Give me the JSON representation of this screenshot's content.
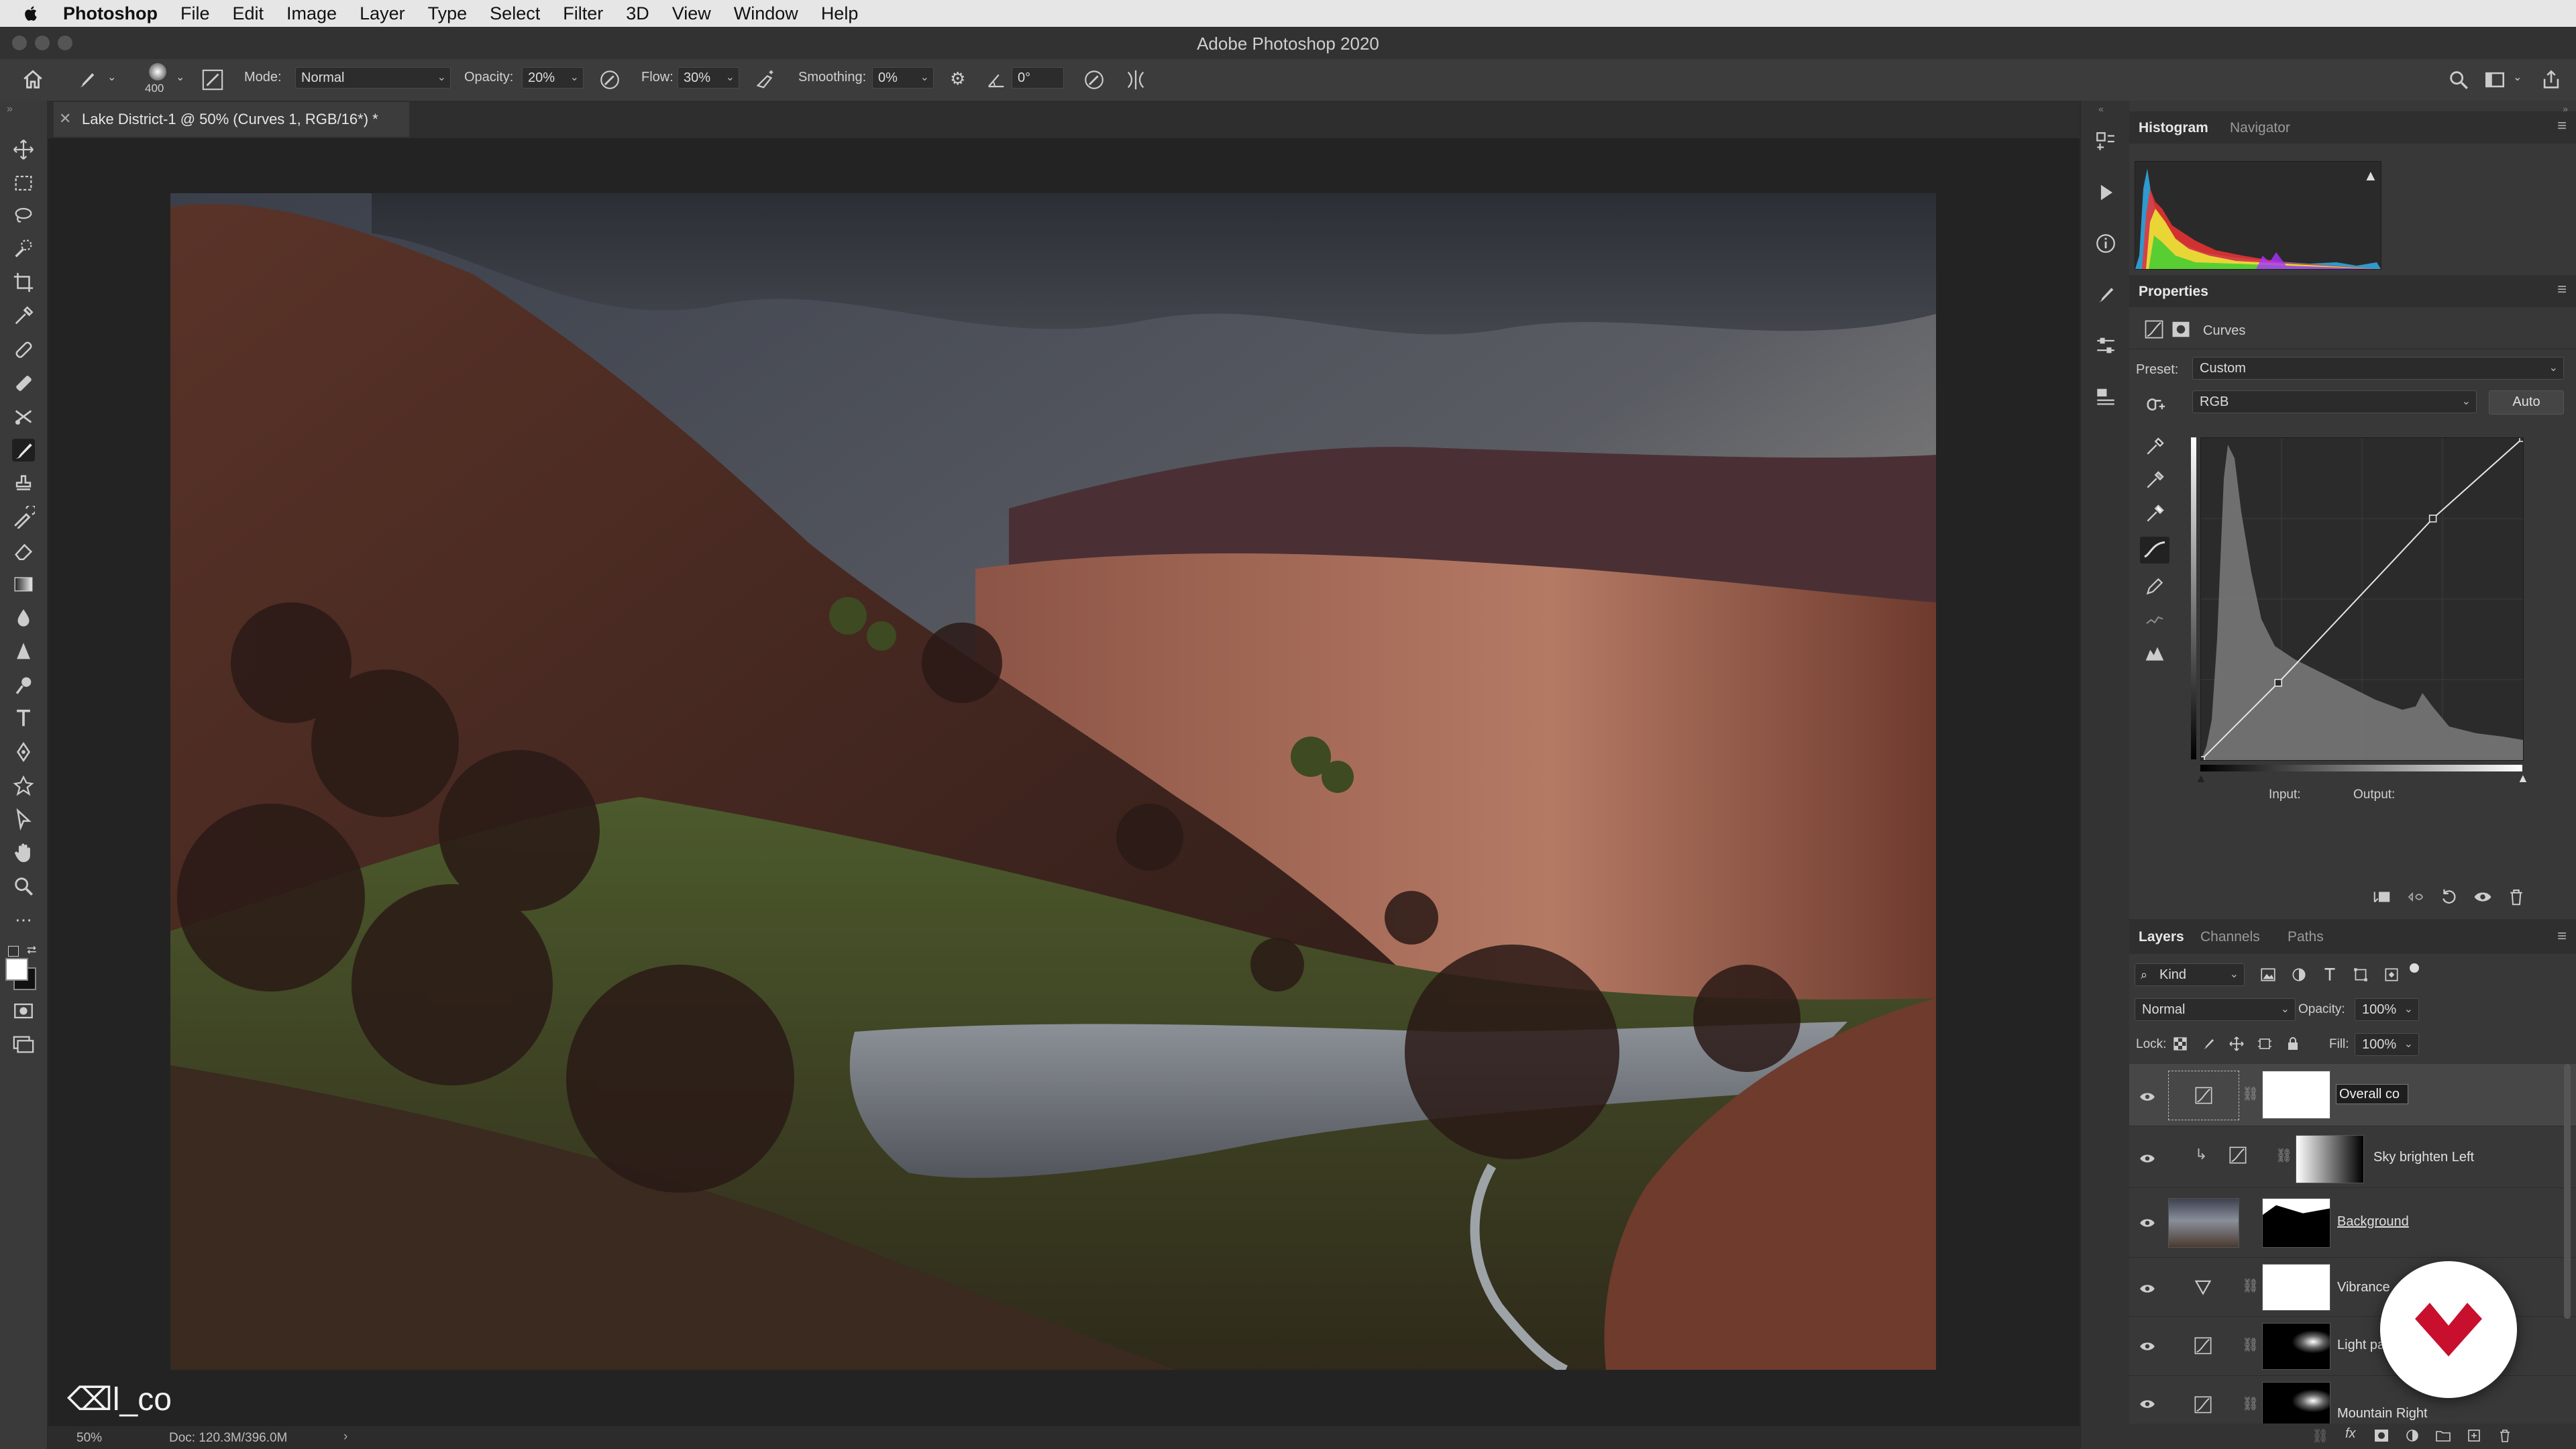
{
  "menubar": {
    "app": "Photoshop",
    "items": [
      "File",
      "Edit",
      "Image",
      "Layer",
      "Type",
      "Select",
      "Filter",
      "3D",
      "View",
      "Window",
      "Help"
    ]
  },
  "window": {
    "title": "Adobe Photoshop 2020"
  },
  "options": {
    "brush_size": "400",
    "mode_label": "Mode:",
    "mode_value": "Normal",
    "opacity_label": "Opacity:",
    "opacity_value": "20%",
    "flow_label": "Flow:",
    "flow_value": "30%",
    "smoothing_label": "Smoothing:",
    "smoothing_value": "0%",
    "angle_value": "0°"
  },
  "document": {
    "tab_title": "Lake District-1 @ 50% (Curves 1, RGB/16*) *",
    "zoom": "50%",
    "doc_size": "Doc: 120.3M/396.0M",
    "watermark": "l_co"
  },
  "histogram_panel": {
    "tabs": [
      "Histogram",
      "Navigator"
    ]
  },
  "properties": {
    "header": "Properties",
    "kind": "Curves",
    "preset_label": "Preset:",
    "preset_value": "Custom",
    "channel_value": "RGB",
    "auto_button": "Auto",
    "input_label": "Input:",
    "output_label": "Output:",
    "curve_points": [
      [
        0,
        0
      ],
      [
        0.24,
        0.24
      ],
      [
        0.72,
        0.75
      ],
      [
        1,
        1
      ]
    ]
  },
  "layers_panel": {
    "tabs": [
      "Layers",
      "Channels",
      "Paths"
    ],
    "filter_kind": "Kind",
    "blend_mode": "Normal",
    "opacity_label": "Opacity:",
    "opacity_value": "100%",
    "lock_label": "Lock:",
    "fill_label": "Fill:",
    "fill_value": "100%",
    "layers": [
      {
        "name": "Overall co"
      },
      {
        "name": "Sky brighten Left"
      },
      {
        "name": "Background"
      },
      {
        "name": "Vibrance"
      },
      {
        "name": "Light pa"
      },
      {
        "name": "Mountain Right"
      }
    ]
  },
  "colors": {
    "ui_dark": "#282828",
    "panel": "#383838",
    "accent_red": "#c8102e"
  }
}
